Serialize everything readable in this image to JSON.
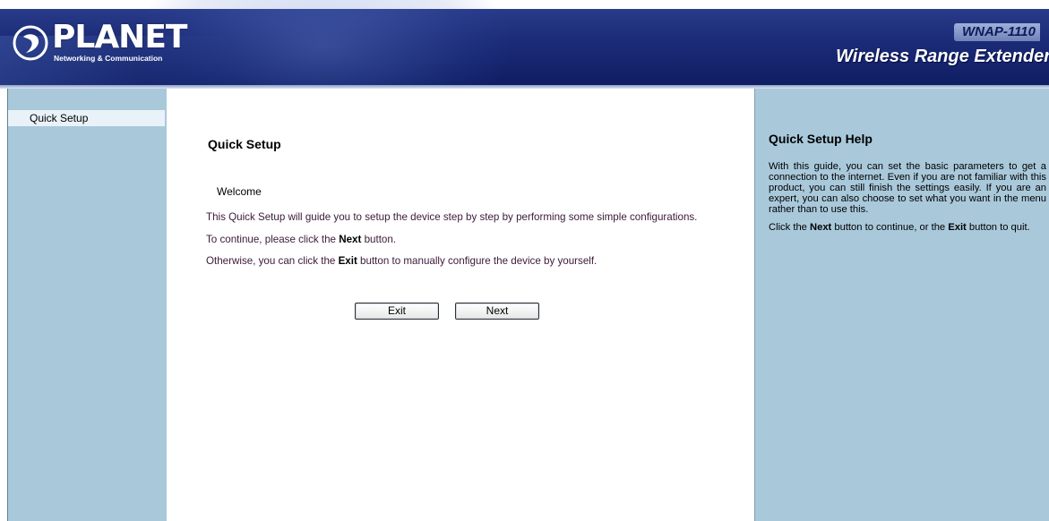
{
  "header": {
    "brand": "PLANET",
    "tagline": "Networking & Communication",
    "model": "WNAP-1110",
    "product": "Wireless Range Extender",
    "colors": {
      "header_dark": "#0f1d63",
      "header_light": "#2c3f8e"
    }
  },
  "sidebar": {
    "items": [
      {
        "label": "Quick Setup",
        "active": true
      }
    ],
    "color": "#a9c9db"
  },
  "main": {
    "title": "Quick Setup",
    "welcome": "Welcome",
    "para1": "This Quick Setup will guide you to setup the device step by step by performing some simple configurations.",
    "para2_before": "To continue, please click the ",
    "para2_bold": "Next",
    "para2_after": " button.",
    "para3_before": "Otherwise, you can click the ",
    "para3_bold": "Exit",
    "para3_after": " button to manually configure the device by yourself.",
    "exit_label": "Exit",
    "next_label": "Next"
  },
  "help": {
    "title": "Quick Setup Help",
    "text1": "With this guide, you can set the basic parameters to get a connection to the internet. Even if you are not familiar with this product, you can still finish the settings easily. If you are an expert, you can also choose to set what you want in the menu rather than to use this.",
    "text2_a": "Click the ",
    "text2_b": "Next",
    "text2_c": " button to continue, or the ",
    "text2_d": "Exit",
    "text2_e": " button to quit."
  }
}
